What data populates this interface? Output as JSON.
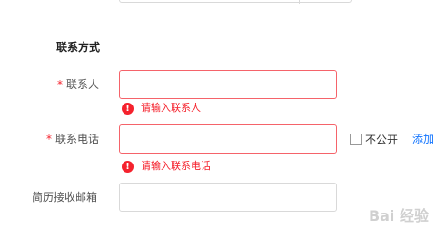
{
  "section": {
    "title": "联系方式"
  },
  "fields": {
    "contact_person": {
      "required_mark": "*",
      "label": "联系人",
      "value": "",
      "error": "请输入联系人"
    },
    "contact_phone": {
      "required_mark": "*",
      "label": "联系电话",
      "value": "",
      "error": "请输入联系电话",
      "private_label": "不公开",
      "private_checked": false,
      "add_label": "添加"
    },
    "resume_email": {
      "label": "简历接收邮箱",
      "value": ""
    }
  },
  "error_icon": {
    "name": "exclamation-circle-icon",
    "glyph": "!",
    "color": "#f5222d"
  },
  "accent_color": "#1677ff",
  "watermark": {
    "text": "Bai 经验"
  }
}
